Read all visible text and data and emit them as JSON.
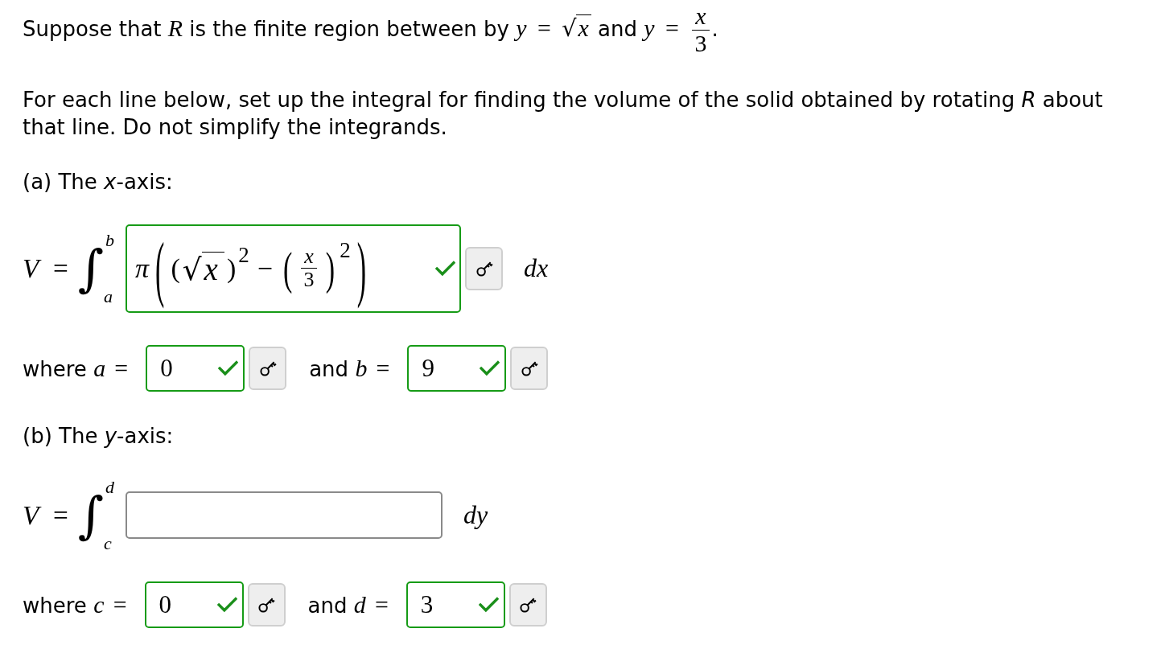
{
  "statement": [
    {
      "kind": "text",
      "text": "Suppose that "
    },
    {
      "kind": "math",
      "text": "R"
    },
    {
      "kind": "text",
      "text": " is the finite region between by "
    },
    {
      "kind": "math",
      "text": "y"
    },
    {
      "kind": "op",
      "text": "="
    },
    {
      "kind": "sqrt",
      "sign": "√",
      "text": "x"
    },
    {
      "kind": "text",
      "text": " and "
    },
    {
      "kind": "math",
      "text": "y"
    },
    {
      "kind": "op",
      "text": "="
    },
    {
      "kind": "frac",
      "num": "x",
      "den": "3"
    },
    {
      "kind": "text",
      "text": "."
    }
  ],
  "instructions": "For each line below, set up the integral for finding the volume of the solid obtained by rotating *R* about that line. Do not simplify the integrands.",
  "parts": [
    {
      "label": "(a) The *x*-axis:",
      "integral": {
        "lhs": "V",
        "eq": "=",
        "sign": "∫",
        "upper": "b",
        "lower": "a",
        "answer": {
          "correct": true,
          "tokens": [
            {
              "kind": "sym",
              "text": "π"
            },
            {
              "kind": "bigparen",
              "text": "("
            },
            {
              "kind": "paren",
              "text": "("
            },
            {
              "kind": "sqrt",
              "sign": "√",
              "text": "x"
            },
            {
              "kind": "paren",
              "text": ")"
            },
            {
              "kind": "sup",
              "text": "2"
            },
            {
              "kind": "op",
              "text": "−"
            },
            {
              "kind": "tallparen",
              "text": "("
            },
            {
              "kind": "frac",
              "num": "x",
              "den": "3"
            },
            {
              "kind": "tallparen",
              "text": ")"
            },
            {
              "kind": "sup",
              "text": "2"
            },
            {
              "kind": "bigparen",
              "text": ")"
            }
          ]
        },
        "differential": "dx"
      },
      "bounds": [
        {
          "word": "where",
          "var": "a",
          "eq": "=",
          "value": "0",
          "correct": true
        },
        {
          "word": "and",
          "var": "b",
          "eq": "=",
          "value": "9",
          "correct": true
        }
      ]
    },
    {
      "label": "(b) The *y*-axis:",
      "integral": {
        "lhs": "V",
        "eq": "=",
        "sign": "∫",
        "upper": "d",
        "lower": "c",
        "answer": {
          "correct": false
        },
        "differential": "dy"
      },
      "bounds": [
        {
          "word": "where",
          "var": "c",
          "eq": "=",
          "value": "0",
          "correct": true
        },
        {
          "word": "and",
          "var": "d",
          "eq": "=",
          "value": "3",
          "correct": true
        }
      ]
    }
  ]
}
